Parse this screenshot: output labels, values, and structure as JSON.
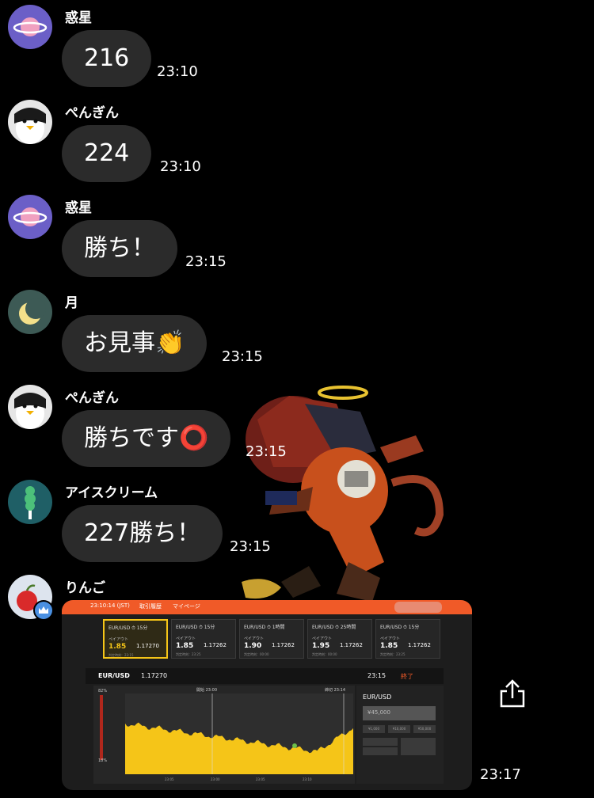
{
  "messages": [
    {
      "sender": "惑星",
      "text": "216",
      "time": "23:10"
    },
    {
      "sender": "ぺんぎん",
      "text": "224",
      "time": "23:10"
    },
    {
      "sender": "惑星",
      "text": "勝ち！",
      "time": "23:15"
    },
    {
      "sender": "月",
      "text": "お見事👏",
      "time": "23:15"
    },
    {
      "sender": "ぺんぎん",
      "text": "勝ちです⭕",
      "time": "23:15"
    },
    {
      "sender": "アイスクリーム",
      "text": "227勝ち！",
      "time": "23:15"
    },
    {
      "sender": "りんご",
      "time": "23:17"
    }
  ],
  "trading_screenshot": {
    "topbar": {
      "clock": "23:10:14 (JST)",
      "menu1": "取引履歴",
      "menu2": "マイページ"
    },
    "cards": [
      {
        "title": "EUR/USD",
        "period": "15分",
        "label": "ペイアウト",
        "payout": "1.85",
        "rate": "1.17270",
        "footer": "判定時刻：23:15"
      },
      {
        "title": "EUR/USD",
        "period": "15分",
        "label": "ペイアウト",
        "payout": "1.85",
        "rate": "1.17262",
        "footer": "判定時刻：23:25"
      },
      {
        "title": "EUR/USD",
        "period": "1時間",
        "label": "ペイアウト",
        "payout": "1.90",
        "rate": "1.17262",
        "footer": "判定時刻：00:00"
      },
      {
        "title": "EUR/USD",
        "period": "25時間",
        "label": "ペイアウト",
        "payout": "1.95",
        "rate": "1.17262",
        "footer": "判定時刻：00:00"
      },
      {
        "title": "EUR/USD",
        "period": "15分",
        "label": "ペイアウト",
        "payout": "1.85",
        "rate": "1.17262",
        "footer": "判定時刻：23:25"
      }
    ],
    "pair": "EUR/USD",
    "pair_rate": "1.17270",
    "expiry": "23:15",
    "status": "終了",
    "panel_title": "EUR/USD",
    "amount": "¥45,000",
    "quick": [
      "¥1,000",
      "¥10,000",
      "¥50,000"
    ],
    "chart_start": "開始 23:00",
    "chart_end": "締切 23:14",
    "x_ticks": [
      "23:05",
      "23:00",
      "23:05",
      "23:10"
    ],
    "pct_top": "82%",
    "pct_bottom": "18%"
  },
  "colors": {
    "bubble": "#2b2b2b",
    "accent": "#f05a28",
    "chart_fill": "#f5c518"
  },
  "icons": {
    "share": "share-icon"
  }
}
